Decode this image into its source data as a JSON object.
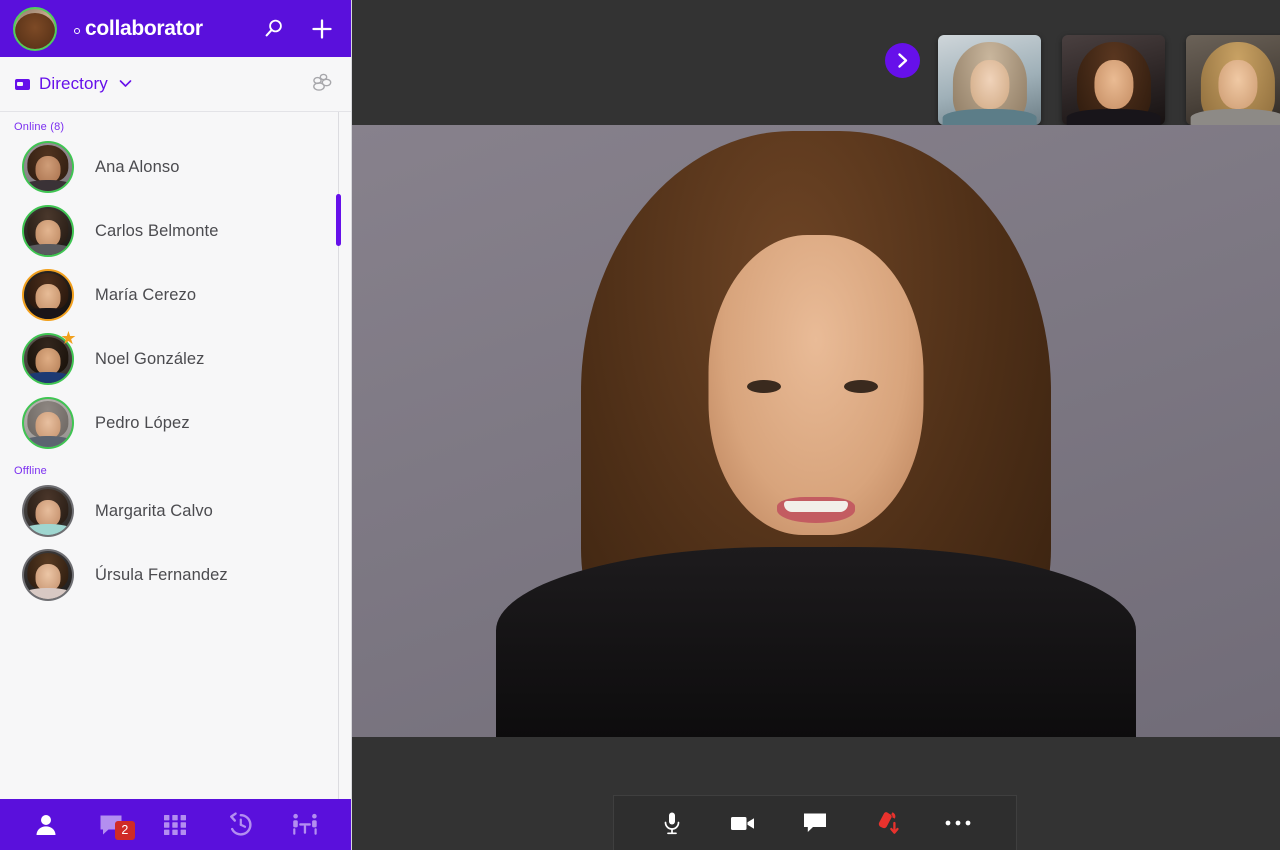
{
  "app": {
    "brand_name": "collaborator",
    "brand_color": "#5A10DC",
    "accent_color": "#6610ea",
    "badge_color": "#d02b26",
    "hangup_color": "#e8322d",
    "status_online_color": "#3fc552",
    "status_away_color": "#f2a01d"
  },
  "header": {
    "avatar_name": "current-user-avatar",
    "search_icon": "search-icon",
    "add_icon": "plus-icon"
  },
  "directory": {
    "label": "Directory",
    "tile_icon": "directory-icon",
    "chevron_icon": "chevron-down-icon",
    "group_icon": "group-people-icon"
  },
  "contacts": {
    "sections": [
      {
        "label": "Online (8)",
        "items": [
          {
            "name": "Ana Alonso",
            "status": "online",
            "favorite": false
          },
          {
            "name": "Carlos Belmonte",
            "status": "online",
            "favorite": false
          },
          {
            "name": "María Cerezo",
            "status": "away",
            "favorite": false
          },
          {
            "name": "Noel González",
            "status": "online",
            "favorite": true
          },
          {
            "name": "Pedro López",
            "status": "online",
            "favorite": false
          }
        ]
      },
      {
        "label": "Offline",
        "items": [
          {
            "name": "Margarita Calvo",
            "status": "offline",
            "favorite": false
          },
          {
            "name": "Úrsula Fernandez",
            "status": "offline",
            "favorite": false
          }
        ]
      }
    ]
  },
  "bottom_nav": {
    "items": [
      {
        "icon": "person-icon",
        "label": "Contacts",
        "active": true,
        "badge": ""
      },
      {
        "icon": "chat-icon",
        "label": "Chats",
        "active": false,
        "badge": "2"
      },
      {
        "icon": "apps-grid-icon",
        "label": "Apps",
        "active": false,
        "badge": ""
      },
      {
        "icon": "history-icon",
        "label": "History",
        "active": false,
        "badge": ""
      },
      {
        "icon": "meeting-icon",
        "label": "Meetings",
        "active": false,
        "badge": ""
      }
    ]
  },
  "stage": {
    "next_button_icon": "chevron-right-icon",
    "thumbnails": [
      {
        "label": "participant-1"
      },
      {
        "label": "participant-2"
      },
      {
        "label": "participant-3"
      }
    ],
    "main_speaker": "active-speaker-video"
  },
  "call_controls": {
    "items": [
      {
        "icon": "microphone-icon",
        "label": "Mute",
        "variant": "normal"
      },
      {
        "icon": "camera-icon",
        "label": "Video",
        "variant": "normal"
      },
      {
        "icon": "chat-icon",
        "label": "Chat",
        "variant": "normal"
      },
      {
        "icon": "hangup-icon",
        "label": "End call",
        "variant": "danger"
      },
      {
        "icon": "more-dots-icon",
        "label": "More",
        "variant": "normal"
      }
    ]
  }
}
